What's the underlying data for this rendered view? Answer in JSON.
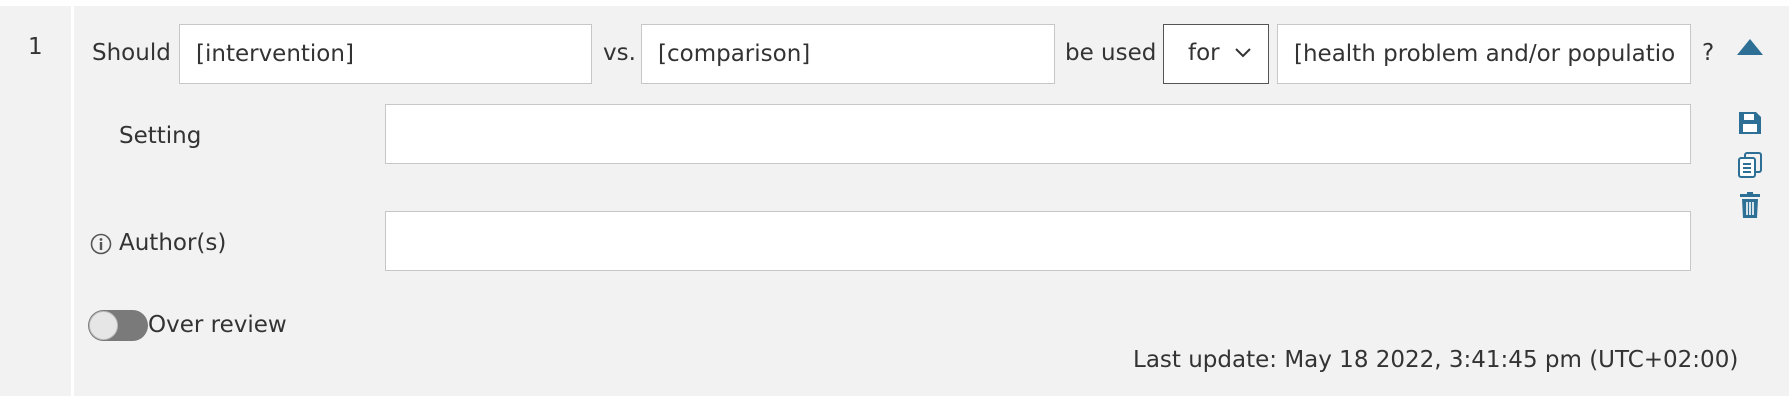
{
  "question": {
    "number": "1",
    "should_label": "Should",
    "intervention_placeholder": "[intervention]",
    "vs_label": "vs.",
    "comparison_placeholder": "[comparison]",
    "be_used_label": "be used",
    "for_select_value": "for",
    "population_placeholder": "[health problem and/or population]",
    "question_mark": "?"
  },
  "setting": {
    "label": "Setting",
    "value": ""
  },
  "authors": {
    "label": "Author(s)",
    "value": ""
  },
  "over_review": {
    "label": "Over review",
    "enabled": false
  },
  "last_update": {
    "text": "Last update: May 18 2022, 3:41:45 pm (UTC+02:00)"
  },
  "icons": {
    "collapse": "triangle-up-icon",
    "save": "floppy-disk-icon",
    "duplicate": "copy-icon",
    "delete": "trash-icon",
    "info": "info-icon"
  },
  "colors": {
    "accent": "#2e6f95",
    "panel_bg": "#f2f2f2"
  }
}
